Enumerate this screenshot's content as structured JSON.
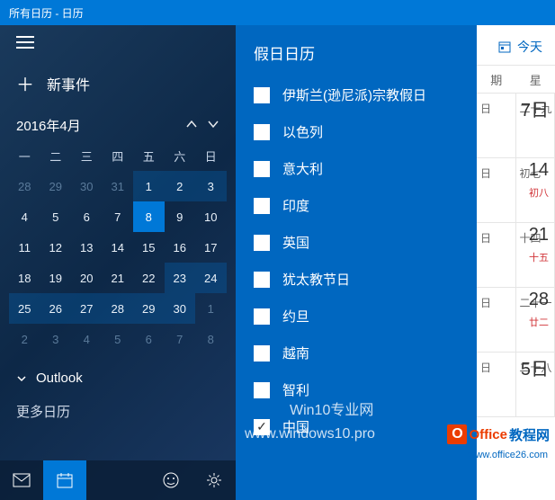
{
  "titlebar": "所有日历 - 日历",
  "sidebar": {
    "new_event": "新事件",
    "month_label": "2016年4月",
    "dow": [
      "一",
      "二",
      "三",
      "四",
      "五",
      "六",
      "日"
    ],
    "weeks": [
      [
        {
          "d": "28",
          "t": "dim"
        },
        {
          "d": "29",
          "t": "dim"
        },
        {
          "d": "30",
          "t": "dim"
        },
        {
          "d": "31",
          "t": "dim"
        },
        {
          "d": "1",
          "t": "hl"
        },
        {
          "d": "2",
          "t": "hl"
        },
        {
          "d": "3",
          "t": "hl"
        }
      ],
      [
        {
          "d": "4",
          "t": "cur"
        },
        {
          "d": "5",
          "t": "cur"
        },
        {
          "d": "6",
          "t": "cur"
        },
        {
          "d": "7",
          "t": "cur"
        },
        {
          "d": "8",
          "t": "today"
        },
        {
          "d": "9",
          "t": "cur"
        },
        {
          "d": "10",
          "t": "cur"
        }
      ],
      [
        {
          "d": "11",
          "t": "cur"
        },
        {
          "d": "12",
          "t": "cur"
        },
        {
          "d": "13",
          "t": "cur"
        },
        {
          "d": "14",
          "t": "cur"
        },
        {
          "d": "15",
          "t": "cur"
        },
        {
          "d": "16",
          "t": "cur"
        },
        {
          "d": "17",
          "t": "cur"
        }
      ],
      [
        {
          "d": "18",
          "t": "cur"
        },
        {
          "d": "19",
          "t": "cur"
        },
        {
          "d": "20",
          "t": "cur"
        },
        {
          "d": "21",
          "t": "cur"
        },
        {
          "d": "22",
          "t": "cur"
        },
        {
          "d": "23",
          "t": "hl"
        },
        {
          "d": "24",
          "t": "hl"
        }
      ],
      [
        {
          "d": "25",
          "t": "hl"
        },
        {
          "d": "26",
          "t": "hl"
        },
        {
          "d": "27",
          "t": "hl"
        },
        {
          "d": "28",
          "t": "hl"
        },
        {
          "d": "29",
          "t": "hl"
        },
        {
          "d": "30",
          "t": "hl"
        },
        {
          "d": "1",
          "t": "dim"
        }
      ],
      [
        {
          "d": "2",
          "t": "dim"
        },
        {
          "d": "3",
          "t": "dim"
        },
        {
          "d": "4",
          "t": "dim"
        },
        {
          "d": "5",
          "t": "dim"
        },
        {
          "d": "6",
          "t": "dim"
        },
        {
          "d": "7",
          "t": "dim"
        },
        {
          "d": "8",
          "t": "dim"
        }
      ]
    ],
    "outlook": "Outlook",
    "more_cal": "更多日历"
  },
  "panel": {
    "title": "假日日历",
    "items": [
      {
        "label": "伊斯兰(逊尼派)宗教假日",
        "checked": false
      },
      {
        "label": "以色列",
        "checked": false
      },
      {
        "label": "意大利",
        "checked": false
      },
      {
        "label": "印度",
        "checked": false
      },
      {
        "label": "英国",
        "checked": false
      },
      {
        "label": "犹太教节日",
        "checked": false
      },
      {
        "label": "约旦",
        "checked": false
      },
      {
        "label": "越南",
        "checked": false
      },
      {
        "label": "智利",
        "checked": false
      },
      {
        "label": "中国",
        "checked": true
      }
    ]
  },
  "right": {
    "today": "今天",
    "dow": [
      "期",
      "星"
    ],
    "rows": [
      {
        "lunar": "二十九",
        "big": "7日",
        "sub": ""
      },
      {
        "lunar": "初七",
        "big": "14",
        "sub": "初八"
      },
      {
        "lunar": "十四",
        "big": "21",
        "sub": "十五"
      },
      {
        "lunar": "二十一",
        "big": "28",
        "sub": "廿二"
      },
      {
        "lunar": "二十八",
        "big": "5日",
        "sub": ""
      }
    ]
  },
  "watermarks": {
    "w1": "Win10专业网",
    "w2": "www.windows10.pro",
    "office1": "Office",
    "office2": "教程网",
    "office_url": "www.office26.com"
  }
}
